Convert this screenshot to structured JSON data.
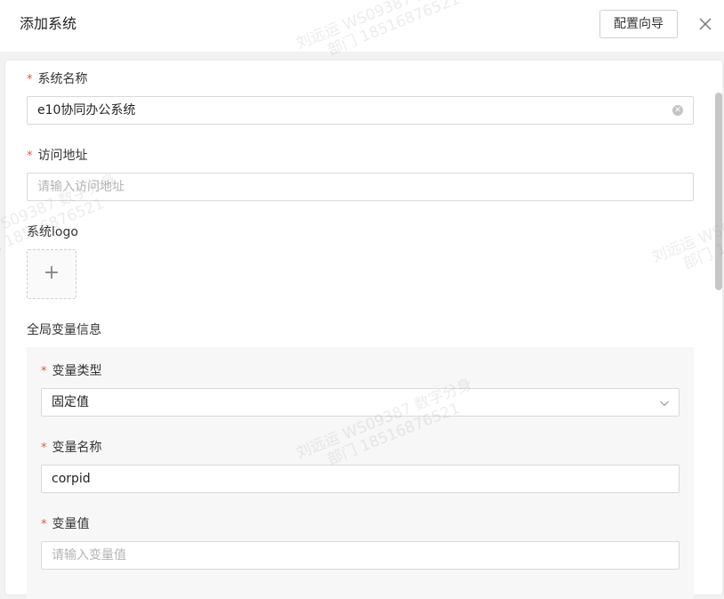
{
  "header": {
    "title": "添加系统",
    "wizard_label": "配置向导",
    "close_icon": "close-icon"
  },
  "form": {
    "required_mark": "*",
    "system_name": {
      "label": "系统名称",
      "value": "e10协同办公系统",
      "clear_icon": "clear-icon"
    },
    "access_url": {
      "label": "访问地址",
      "placeholder": "请输入访问地址"
    },
    "logo": {
      "label": "系统logo",
      "upload_symbol": "+"
    },
    "global_vars": {
      "label": "全局变量信息",
      "var_type": {
        "label": "变量类型",
        "value": "固定值"
      },
      "var_name": {
        "label": "变量名称",
        "value": "corpid"
      },
      "var_value": {
        "label": "变量值",
        "placeholder": "请输入变量值"
      }
    }
  },
  "watermark": {
    "line1": "刘远运 WS09387 数字分身",
    "line2": "部门 18516876521"
  },
  "colors": {
    "required": "#e5534b",
    "background": "#f2f2f2",
    "variables_background": "#f7f7f7"
  }
}
